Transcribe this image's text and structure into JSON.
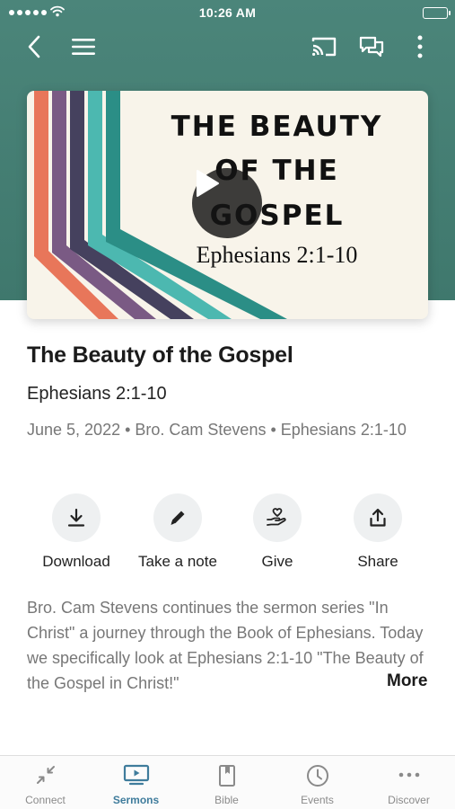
{
  "status_bar": {
    "time": "10:26 AM"
  },
  "header": {
    "back_icon": "chevron-left-icon",
    "menu_icon": "hamburger-menu-icon",
    "cast_icon": "cast-icon",
    "chat_icon": "chat-bubbles-icon",
    "more_icon": "vertical-dots-icon"
  },
  "artwork": {
    "line1": "THE BEAUTY",
    "line2": "OF THE",
    "line3": "GOSPEL",
    "reference": "Ephesians 2:1-10",
    "stripe_colors": [
      "#e8765a",
      "#7a5a84",
      "#45415e",
      "#4cb8b0",
      "#2b8e86"
    ]
  },
  "sermon": {
    "title": "The Beauty of the Gospel",
    "scripture": "Ephesians 2:1-10",
    "meta": "June 5, 2022 • Bro. Cam Stevens • Ephesians 2:1-10",
    "description": "Bro. Cam Stevens continues the sermon series \"In Christ\" a journey through the Book of Ephesians. Today we specifically look at Ephesians 2:1-10 \"The Beauty of the Gospel in Christ!\"",
    "more_label": "More"
  },
  "actions": [
    {
      "label": "Download",
      "icon": "download-icon"
    },
    {
      "label": "Take a note",
      "icon": "pencil-icon"
    },
    {
      "label": "Give",
      "icon": "give-hand-heart-icon"
    },
    {
      "label": "Share",
      "icon": "share-icon"
    }
  ],
  "tabs": [
    {
      "label": "Connect",
      "icon": "connect-icon",
      "active": false
    },
    {
      "label": "Sermons",
      "icon": "sermons-tv-icon",
      "active": true
    },
    {
      "label": "Bible",
      "icon": "bible-icon",
      "active": false
    },
    {
      "label": "Events",
      "icon": "clock-icon",
      "active": false
    },
    {
      "label": "Discover",
      "icon": "more-horizontal-icon",
      "active": false
    }
  ],
  "colors": {
    "header_bg": "#4b857a",
    "accent": "#3f7c9c",
    "muted_text": "#777777"
  }
}
